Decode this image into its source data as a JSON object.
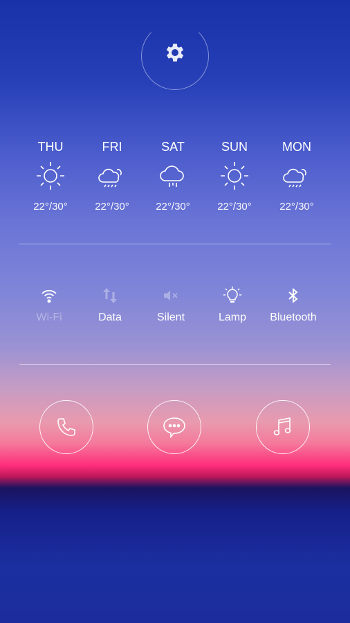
{
  "weather": [
    {
      "day": "THU",
      "icon": "sun-icon",
      "temp": "22°/30°"
    },
    {
      "day": "FRI",
      "icon": "cloud-sun-rain-icon",
      "temp": "22°/30°"
    },
    {
      "day": "SAT",
      "icon": "cloud-rain-icon",
      "temp": "22°/30°"
    },
    {
      "day": "SUN",
      "icon": "sun-icon",
      "temp": "22°/30°"
    },
    {
      "day": "MON",
      "icon": "cloud-sun-rain-icon",
      "temp": "22°/30°"
    }
  ],
  "toggles": [
    {
      "label": "Wi-Fi",
      "icon": "wifi-icon",
      "icon_active": true,
      "label_active": false
    },
    {
      "label": "Data",
      "icon": "data-arrows-icon",
      "icon_active": false,
      "label_active": true
    },
    {
      "label": "Silent",
      "icon": "mute-icon",
      "icon_active": false,
      "label_active": true
    },
    {
      "label": "Lamp",
      "icon": "bulb-icon",
      "icon_active": true,
      "label_active": true
    },
    {
      "label": "Bluetooth",
      "icon": "bluetooth-icon",
      "icon_active": true,
      "label_active": true
    }
  ],
  "dock": [
    "phone-icon",
    "message-icon",
    "music-icon"
  ]
}
